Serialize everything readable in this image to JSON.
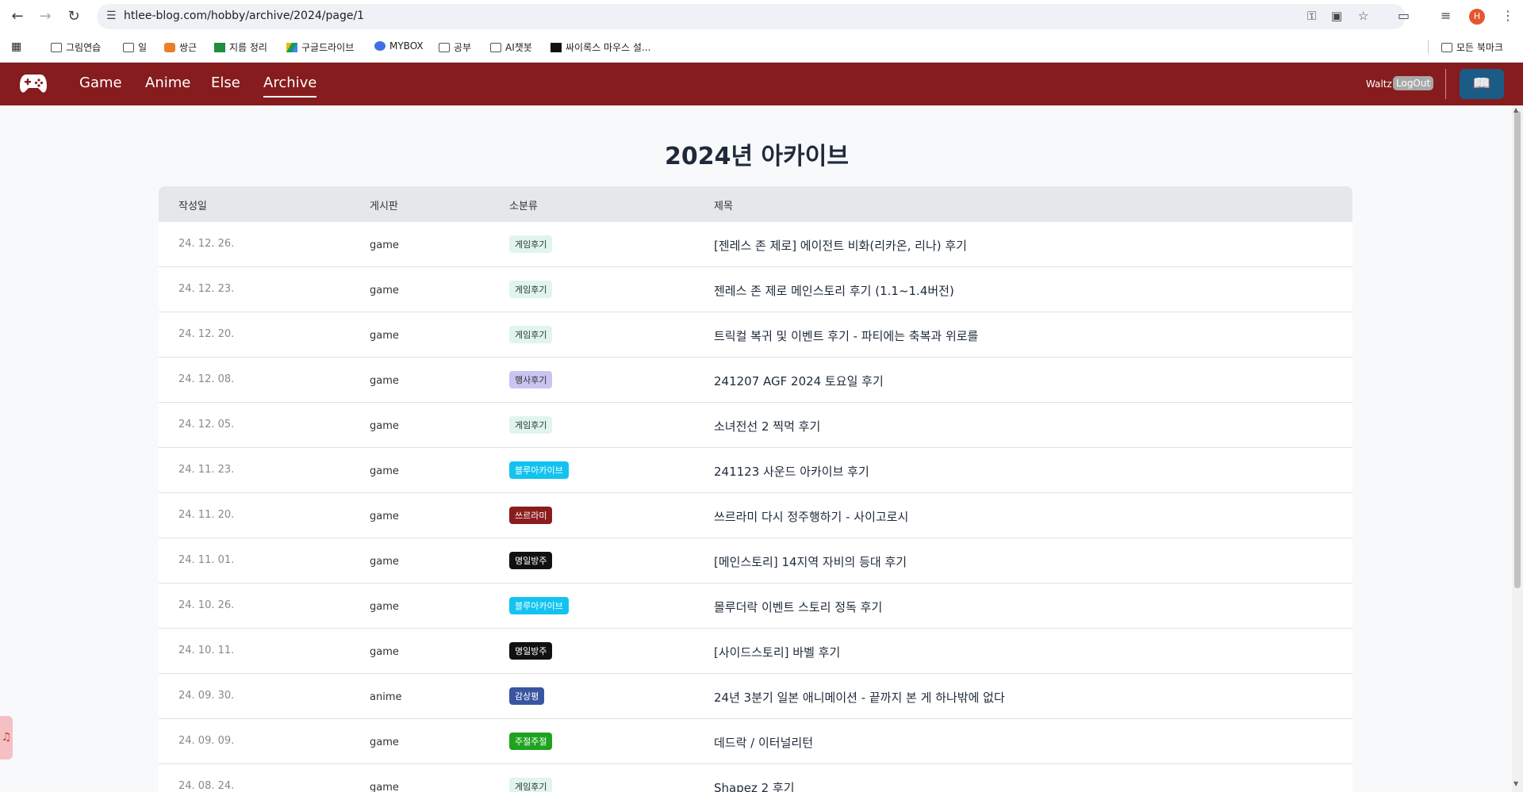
{
  "browser": {
    "url": "htlee-blog.com/hobby/archive/2024/page/1",
    "bookmarks": [
      {
        "label": "그림연습",
        "icon": "folder-icon"
      },
      {
        "label": "일",
        "icon": "folder-icon"
      },
      {
        "label": "쌍근",
        "icon": "carrot-icon"
      },
      {
        "label": "지름 정리",
        "icon": "sheets-icon"
      },
      {
        "label": "구글드라이브",
        "icon": "drive-icon"
      },
      {
        "label": "MYBOX",
        "icon": "mybox-icon"
      },
      {
        "label": "공부",
        "icon": "folder-icon"
      },
      {
        "label": "AI챗봇",
        "icon": "folder-icon"
      },
      {
        "label": "싸이록스 마우스 설...",
        "icon": "mouse-icon"
      }
    ],
    "all_bookmarks": "모든 북마크",
    "profile_initial": "H"
  },
  "site": {
    "nav": [
      {
        "label": "Game"
      },
      {
        "label": "Anime"
      },
      {
        "label": "Else"
      },
      {
        "label": "Archive"
      }
    ],
    "user": "Waltz",
    "logout": "LogOut",
    "brand_color": "#861c1e"
  },
  "main": {
    "title": "2024년 아카이브",
    "columns": [
      "작성일",
      "게시판",
      "소분류",
      "제목"
    ],
    "rows": [
      {
        "date": "24. 12. 26.",
        "board": "game",
        "tag": "게임후기",
        "title": "[젠레스 존 제로] 에이전트 비화(리카온, 리나) 후기"
      },
      {
        "date": "24. 12. 23.",
        "board": "game",
        "tag": "게임후기",
        "title": "젠레스 존 제로 메인스토리 후기 (1.1~1.4버전)"
      },
      {
        "date": "24. 12. 20.",
        "board": "game",
        "tag": "게임후기",
        "title": "트릭컬 복귀 및 이벤트 후기 - 파티에는 축복과 위로를"
      },
      {
        "date": "24. 12. 08.",
        "board": "game",
        "tag": "행사후기",
        "title": "241207 AGF 2024 토요일 후기"
      },
      {
        "date": "24. 12. 05.",
        "board": "game",
        "tag": "게임후기",
        "title": "소녀전선 2 찍먹 후기"
      },
      {
        "date": "24. 11. 23.",
        "board": "game",
        "tag": "블루아카이브",
        "title": "241123 사운드 아카이브 후기"
      },
      {
        "date": "24. 11. 20.",
        "board": "game",
        "tag": "쓰르라미",
        "title": "쓰르라미 다시 정주행하기 - 사이고로시"
      },
      {
        "date": "24. 11. 01.",
        "board": "game",
        "tag": "명일방주",
        "title": "[메인스토리] 14지역 자비의 등대 후기"
      },
      {
        "date": "24. 10. 26.",
        "board": "game",
        "tag": "블루아카이브",
        "title": "몰루더락 이벤트 스토리 정독 후기"
      },
      {
        "date": "24. 10. 11.",
        "board": "game",
        "tag": "명일방주",
        "title": "[사이드스토리] 바벨 후기"
      },
      {
        "date": "24. 09. 30.",
        "board": "anime",
        "tag": "감상평",
        "title": "24년 3분기 일본 애니메이션 - 끝까지 본 게 하나밖에 없다"
      },
      {
        "date": "24. 09. 09.",
        "board": "game",
        "tag": "주절주절",
        "title": "데드락 / 이터널리턴"
      },
      {
        "date": "24. 08. 24.",
        "board": "game",
        "tag": "게임후기",
        "title": "Shapez 2 후기"
      }
    ],
    "tag_colors": {
      "게임후기": {
        "bg": "#dff5ee",
        "fg": "#333333"
      },
      "행사후기": {
        "bg": "#c9c4f0",
        "fg": "#333333"
      },
      "블루아카이브": {
        "bg": "#12c3f0",
        "fg": "#ffffff"
      },
      "쓰르라미": {
        "bg": "#8b1c1e",
        "fg": "#ffffff"
      },
      "명일방주": {
        "bg": "#111111",
        "fg": "#ffffff"
      },
      "감상평": {
        "bg": "#3a55a0",
        "fg": "#ffffff"
      },
      "주절주절": {
        "bg": "#1fa31f",
        "fg": "#ffffff"
      }
    }
  }
}
